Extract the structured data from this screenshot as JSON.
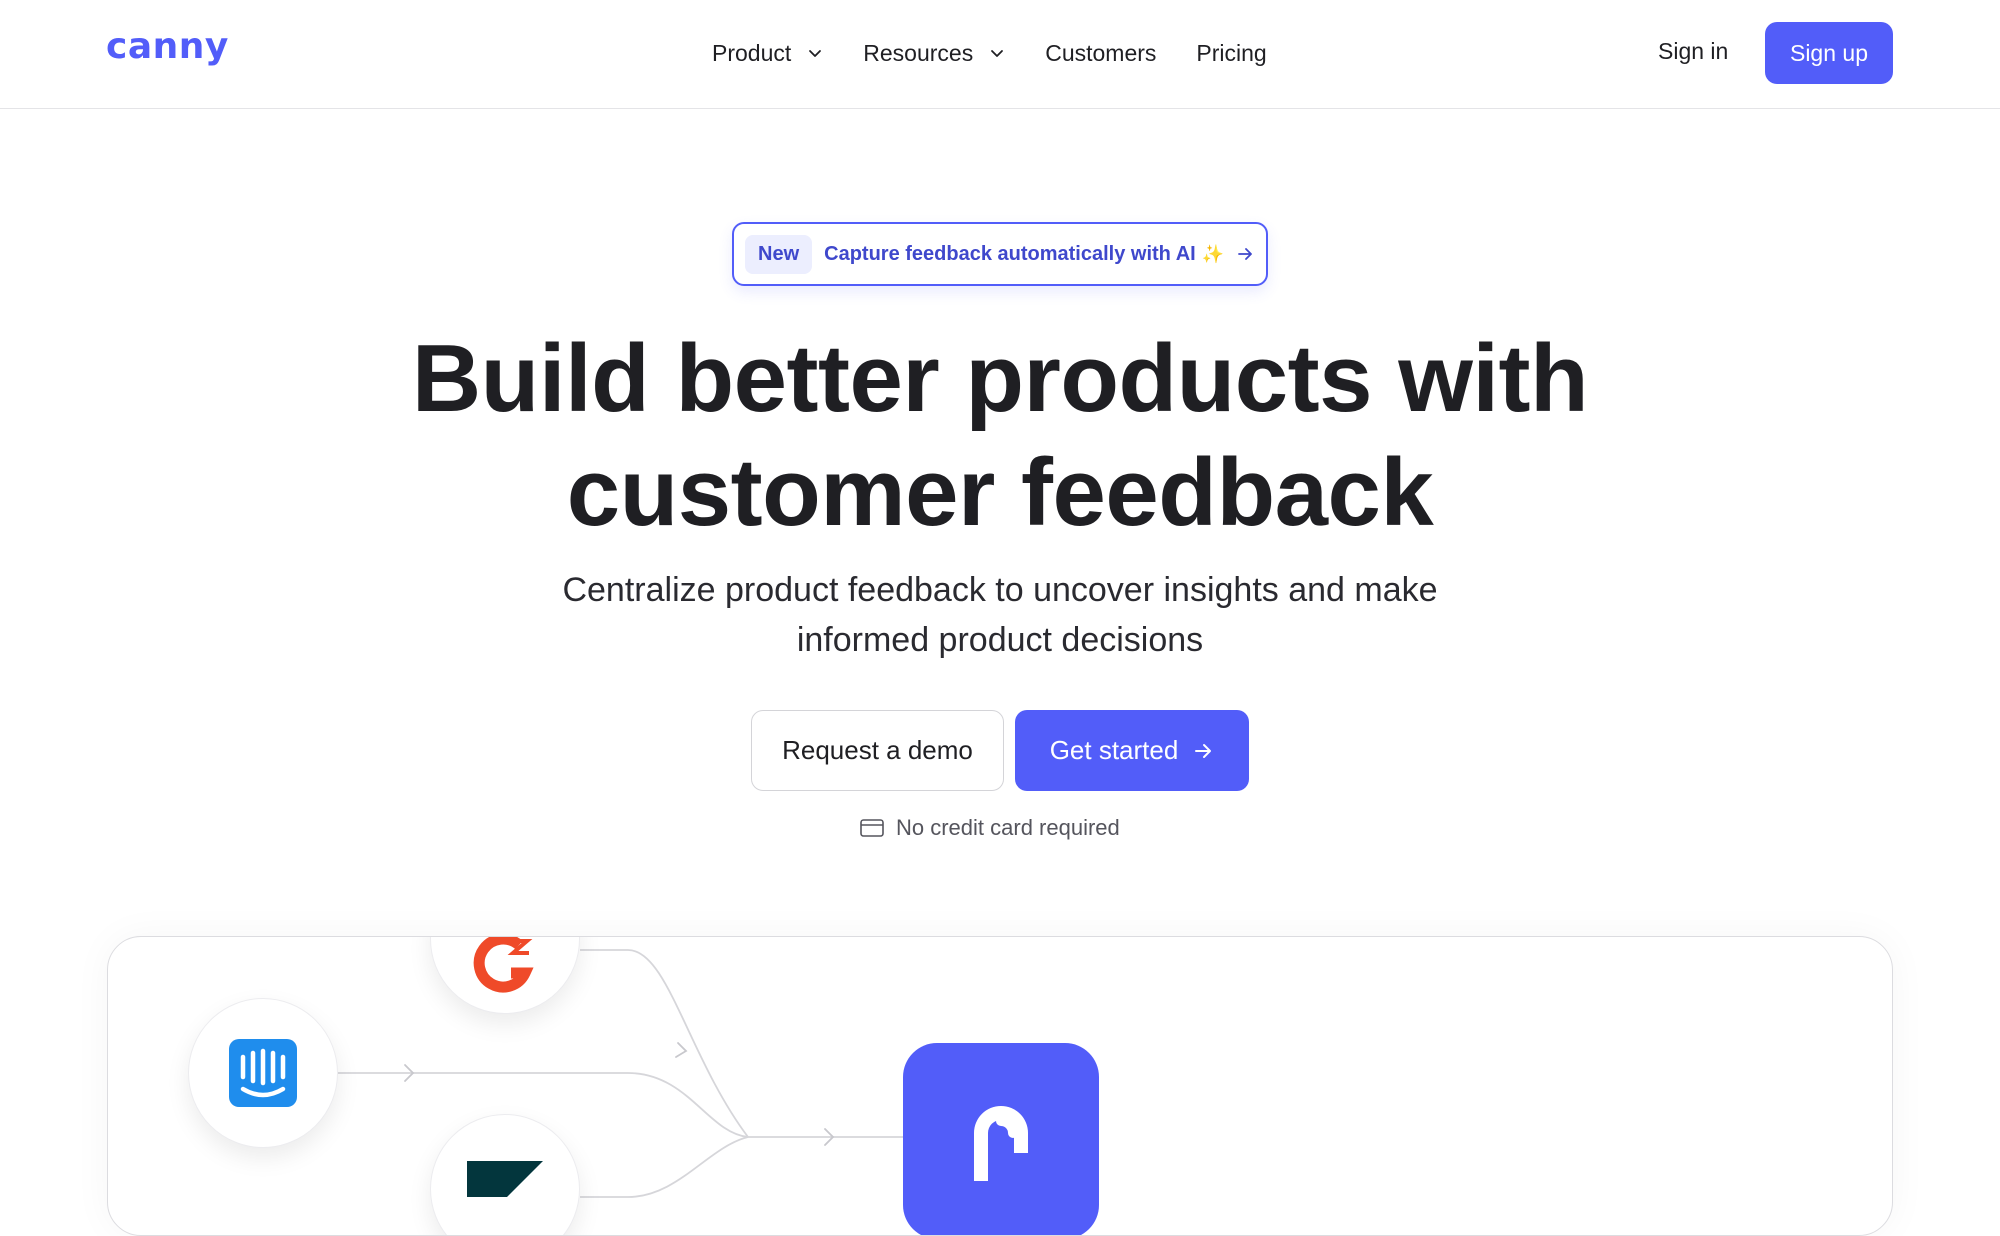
{
  "header": {
    "logo": "canny",
    "nav": {
      "product": "Product",
      "resources": "Resources",
      "customers": "Customers",
      "pricing": "Pricing"
    },
    "sign_in": "Sign in",
    "sign_up": "Sign up"
  },
  "hero": {
    "badge": "New",
    "announcement": "Capture feedback automatically with AI",
    "announcement_sparkle": "✨",
    "headline_line1": "Build better products with",
    "headline_line2": "customer feedback",
    "subhead_line1": "Centralize product feedback to uncover insights and make",
    "subhead_line2": "informed product decisions",
    "demo_button": "Request a demo",
    "start_button": "Get started",
    "no_card": "No credit card required"
  },
  "integrations": {
    "sources": [
      "intercom-icon",
      "g2-icon",
      "zendesk-icon"
    ],
    "destination": "canny-app-icon"
  },
  "colors": {
    "brand": "#525df9",
    "text": "#1f1f23",
    "muted": "#55555d",
    "g2": "#ef4a29",
    "intercom": "#1f8ded",
    "zendesk": "#03363d"
  }
}
